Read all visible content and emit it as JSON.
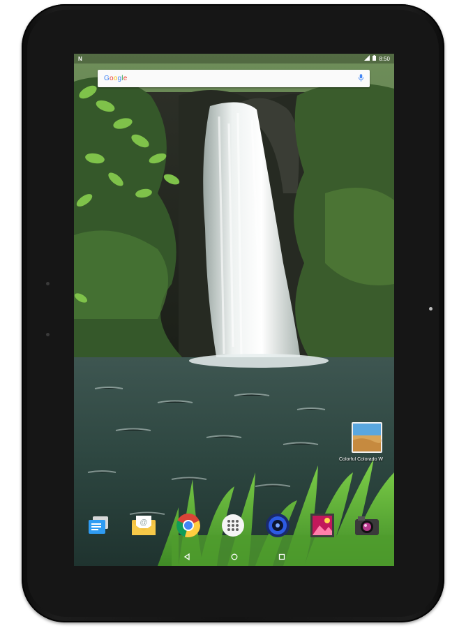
{
  "device": {
    "type": "tablet"
  },
  "status_bar": {
    "notification_icon": "n-icon",
    "time": "8:50",
    "icons": [
      "wifi-icon",
      "battery-icon"
    ]
  },
  "search_bar": {
    "logo_text": "Google",
    "mic_icon": "mic-icon"
  },
  "desktop_shortcut": {
    "label": "Colorful Colorado W",
    "icon": "desert-landscape-icon"
  },
  "dock": {
    "apps": [
      {
        "name": "messages",
        "icon": "messaging-icon"
      },
      {
        "name": "email",
        "icon": "email-icon"
      },
      {
        "name": "chrome",
        "icon": "chrome-icon"
      },
      {
        "name": "all-apps",
        "icon": "app-drawer-icon"
      },
      {
        "name": "music",
        "icon": "music-speaker-icon"
      },
      {
        "name": "gallery",
        "icon": "gallery-icon"
      },
      {
        "name": "camera",
        "icon": "camera-icon"
      }
    ]
  },
  "nav_bar": {
    "buttons": [
      "back-icon",
      "home-icon",
      "recents-icon"
    ]
  },
  "colors": {
    "accent_mic": "#4285f4",
    "google_blue": "#4285f4",
    "google_red": "#ea4335",
    "google_yellow": "#fbbc05",
    "google_green": "#34a853"
  }
}
